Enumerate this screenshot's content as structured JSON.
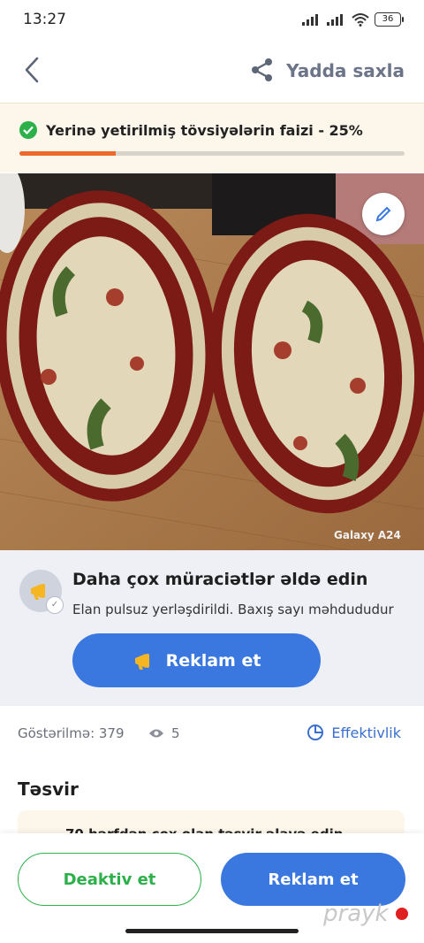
{
  "status_bar": {
    "time": "13:27",
    "battery": "36"
  },
  "header": {
    "save_label": "Yadda saxla"
  },
  "progress": {
    "text": "Yerinə yetirilmiş tövsiyələrin faizi - 25%",
    "percent": 25,
    "fill_color": "#ee6a2a"
  },
  "photo": {
    "camera_label": "Galaxy A24"
  },
  "promo": {
    "title": "Daha çox müraciətlər əldə edin",
    "subtitle": "Elan pulsuz yerləşdirildi. Baxış sayı məhdududur",
    "button_label": "Reklam et"
  },
  "stats": {
    "impressions": "Göstərilmə: 379",
    "views": "5",
    "effectiveness_label": "Effektivlik"
  },
  "description": {
    "title": "Təsvir",
    "hint": "70 hərfdən çox olan təsvir əlavə edin"
  },
  "bottom": {
    "deactivate_label": "Deaktiv et",
    "advertise_label": "Reklam et"
  },
  "watermark": "prayk",
  "colors": {
    "accent_blue": "#3a78e0",
    "success_green": "#2bb04a",
    "progress_orange": "#ee6a2a"
  }
}
